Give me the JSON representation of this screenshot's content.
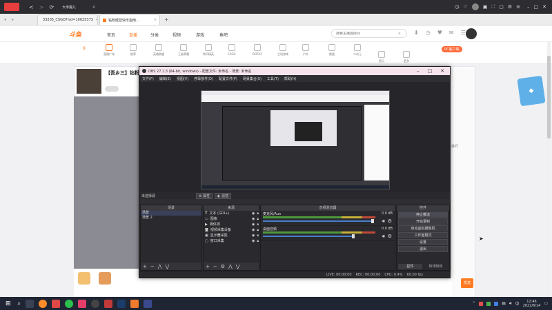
{
  "browser": {
    "window_title": "大米魔儿",
    "tabs": [
      {
        "label": "33205_CSGO?hid=10625373"
      },
      {
        "label": "钻粉经营快乐指南..."
      }
    ],
    "new_tab": "+"
  },
  "site": {
    "logo": "斗鱼",
    "nav": [
      "首页",
      "直播",
      "分类",
      "视频",
      "游戏",
      "鱼吧"
    ],
    "search_placeholder": "搜索主播或房间",
    "categories": [
      "正在直播",
      "直播广场",
      "推荐",
      "英雄联盟",
      "王者荣耀",
      "和平精英",
      "CSGO",
      "DOTA2",
      "主机游戏",
      "户外",
      "颜值",
      "二次元",
      "音乐",
      "更多"
    ],
    "room_title": "【吾乡三】钻粉...",
    "pc_client": "PC客户端",
    "follow_count": "9",
    "chat_rank_labels": [
      "主播",
      "鱼丸",
      "排行"
    ],
    "gift_bar": [
      "鱼丸",
      "办卡",
      "弹幕"
    ],
    "send_label": "发送"
  },
  "obs": {
    "title": "OBS 27.1.3 (64-bit, windows) - 配置文件: 未命名 - 场景: 未命名",
    "menu": [
      "文件(F)",
      "编辑(E)",
      "视图(V)",
      "停靠部件(D)",
      "配置文件(P)",
      "场景集合(S)",
      "工具(T)",
      "帮助(H)"
    ],
    "no_source": "未选择源",
    "props_btn": "属性",
    "filters_btn": "滤镜",
    "docks": {
      "scenes": {
        "title": "场景",
        "items": [
          "场景",
          "场景 2"
        ]
      },
      "sources": {
        "title": "来源",
        "items": [
          "文本 (GDI+)",
          "图像",
          "媒体源",
          "视频采集设备",
          "显示器采集",
          "窗口采集"
        ]
      },
      "mixer": {
        "title": "音频混音器",
        "tracks": [
          {
            "name": "麦克风/Aux",
            "db": "0.0 dB"
          },
          {
            "name": "桌面音频",
            "db": "0.0 dB"
          }
        ]
      },
      "controls": {
        "title": "控件",
        "buttons": [
          "停止推流",
          "开始录制",
          "启动虚拟摄像机",
          "工作室模式",
          "设置",
          "退出"
        ],
        "bottom_tabs": [
          "控件",
          "转场特效"
        ]
      }
    },
    "status": {
      "live": "LIVE: 00:00:00",
      "rec": "REC: 00:00:00",
      "cpu": "CPU: 0.4%",
      "fps": "60.00 fps"
    }
  },
  "taskbar": {
    "time": "12:46",
    "date": "2022/6/14"
  },
  "colors": {
    "brand_orange": "#ff7a22",
    "obs_bg": "#2f2f33",
    "obs_title": "#f6e3ec",
    "taskbar": "#1f2533"
  }
}
